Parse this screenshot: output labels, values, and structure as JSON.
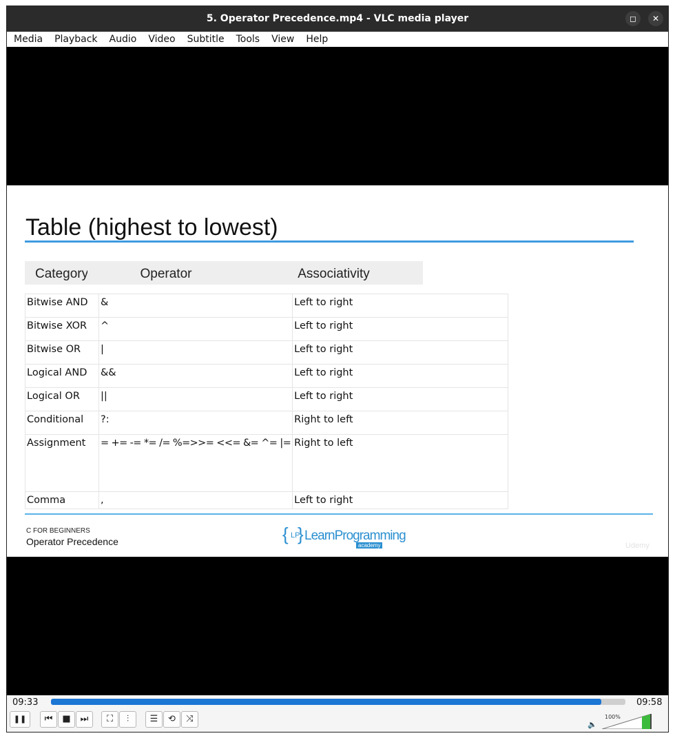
{
  "window": {
    "title": "5. Operator Precedence.mp4 - VLC media player",
    "restore_glyph": "◻",
    "close_glyph": "✕"
  },
  "menu": [
    "Media",
    "Playback",
    "Audio",
    "Video",
    "Subtitle",
    "Tools",
    "View",
    "Help"
  ],
  "slide": {
    "title": "Table (highest to lowest)",
    "headers": {
      "category": "Category",
      "operator": "Operator",
      "associativity": "Associativity"
    },
    "rows": [
      {
        "category": "Bitwise AND",
        "operator": "&",
        "associativity": "Left to right"
      },
      {
        "category": "Bitwise XOR",
        "operator": "^",
        "associativity": "Left to right"
      },
      {
        "category": "Bitwise OR",
        "operator": "|",
        "associativity": "Left to right"
      },
      {
        "category": "Logical AND",
        "operator": "&&",
        "associativity": "Left to right"
      },
      {
        "category": "Logical OR",
        "operator": "||",
        "associativity": "Left to right"
      },
      {
        "category": "Conditional",
        "operator": "?:",
        "associativity": "Right to left"
      },
      {
        "category": "Assignment",
        "operator": "= += -= *= /= %=>>= <<= &= ^= |=",
        "associativity": "Right to left"
      },
      {
        "category": "Comma",
        "operator": ",",
        "associativity": "Left to right"
      }
    ],
    "course": "C FOR BEGINNERS",
    "lesson": "Operator Precedence",
    "logo_text": "LearnProgramming",
    "logo_initials": "LP",
    "logo_sub": "academy",
    "watermark": "Udemy"
  },
  "controls": {
    "elapsed": "09:33",
    "total": "09:58",
    "progress": 0.958,
    "volume_label": "100%",
    "volume_level": 1.0,
    "accent": "#1b76d4",
    "buttons": {
      "pause": "❚❚",
      "prev": "⏮",
      "stop": "■",
      "next": "⏭",
      "fullscreen": "⛶",
      "extended": "⫶",
      "playlist": "☰",
      "loop": "⟲",
      "shuffle": "⤨"
    }
  }
}
